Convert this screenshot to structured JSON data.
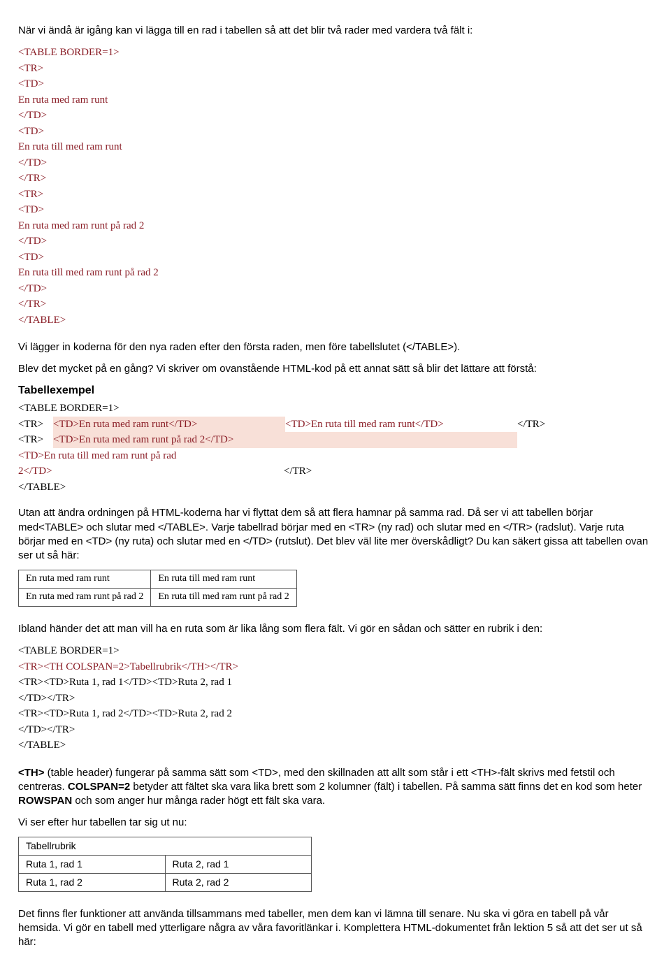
{
  "p_intro": "När vi ändå är igång kan vi lägga till en rad i tabellen så att det blir två rader med vardera två fält i:",
  "code1": [
    "<TABLE BORDER=1>",
    "<TR>",
    "<TD>",
    "En ruta med ram runt",
    "</TD>",
    "<TD>",
    "En ruta till med ram runt",
    "</TD>",
    "</TR>",
    "<TR>",
    "<TD>",
    "En ruta med ram runt på rad 2",
    "</TD>",
    "<TD>",
    "En ruta till med ram runt på rad 2",
    "</TD>",
    "</TR>",
    "</TABLE>"
  ],
  "p_after_code1": "Vi lägger in koderna för den nya raden efter den första raden, men före tabellslutet (</TABLE>).",
  "p_mycket": "Blev det mycket på en gång? Vi skriver om ovanstående HTML-kod på ett annat sätt så blir det lättare att förstå:",
  "h_tabex": "Tabellexempel",
  "tx": {
    "open": "<TABLE BORDER=1>",
    "r1": {
      "tr_open": "<TR>",
      "td1": "<TD>En ruta med ram runt</TD>",
      "td2": "<TD>En ruta till med ram runt</TD>",
      "tr_close": "</TR>"
    },
    "r2": {
      "tr_open": "<TR>",
      "td1": "<TD>En ruta med ram runt på rad 2</TD>",
      "td2_a": "<TD>En ruta till med ram runt på rad",
      "td2_b": "2</TD>",
      "tr_close": "</TR>"
    },
    "close": "</TABLE>"
  },
  "p_utan": "Utan att ändra ordningen på HTML-koderna har vi flyttat dem så att flera hamnar på samma rad. Då ser vi att tabellen börjar med<TABLE> och slutar med </TABLE>. Varje tabellrad börjar med en <TR> (ny rad) och slutar med en </TR> (radslut). Varje ruta börjar med en <TD> (ny ruta) och slutar med en </TD> (rutslut). Det blev väl lite mer överskådligt? Du kan säkert gissa att tabellen ovan ser ut så här:",
  "rendered1": [
    [
      "En ruta med ram runt",
      "En ruta till med ram runt"
    ],
    [
      "En ruta med ram runt på rad 2",
      "En ruta till med ram runt på rad 2"
    ]
  ],
  "p_ibland": "Ibland händer det att man vill ha en ruta som är lika lång som flera fält. Vi gör en sådan och sätter en rubrik i den:",
  "code2": {
    "l1": "<TABLE BORDER=1>",
    "l2": "<TR><TH COLSPAN=2>Tabellrubrik</TH></TR>",
    "l3": "<TR><TD>Ruta 1, rad 1</TD><TD>Ruta 2, rad 1",
    "l4": "</TD></TR>",
    "l5": "<TR><TD>Ruta 1, rad 2</TD><TD>Ruta 2, rad 2",
    "l6": "</TD></TR>",
    "l7": "</TABLE>"
  },
  "p_th_1a": "<TH>",
  "p_th_1b": " (table header) fungerar på samma sätt som <TD>, med den skillnaden att allt som står i ett <TH>-fält skrivs med fetstil och centreras. ",
  "p_th_1c": "COLSPAN=2",
  "p_th_1d": " betyder att fältet ska vara lika brett som 2 kolumner (fält) i tabellen. På samma sätt finns det en kod som heter ",
  "p_th_1e": "ROWSPAN",
  "p_th_1f": " och som anger hur många rader högt ett fält ska vara.",
  "p_viser": "Vi ser efter hur tabellen tar sig ut nu:",
  "rendered2": {
    "head": "Tabellrubrik",
    "rows": [
      [
        "Ruta 1, rad 1",
        "Ruta 2, rad 1"
      ],
      [
        "Ruta 1, rad 2",
        "Ruta 2, rad 2"
      ]
    ]
  },
  "p_final": "Det finns fler funktioner att använda tillsammans med tabeller, men dem kan vi lämna till senare. Nu ska vi göra en tabell på vår hemsida. Vi gör en tabell med ytterligare några av våra favoritlänkar i. Komplettera HTML-dokumentet från lektion 5 så att det ser ut så här:"
}
